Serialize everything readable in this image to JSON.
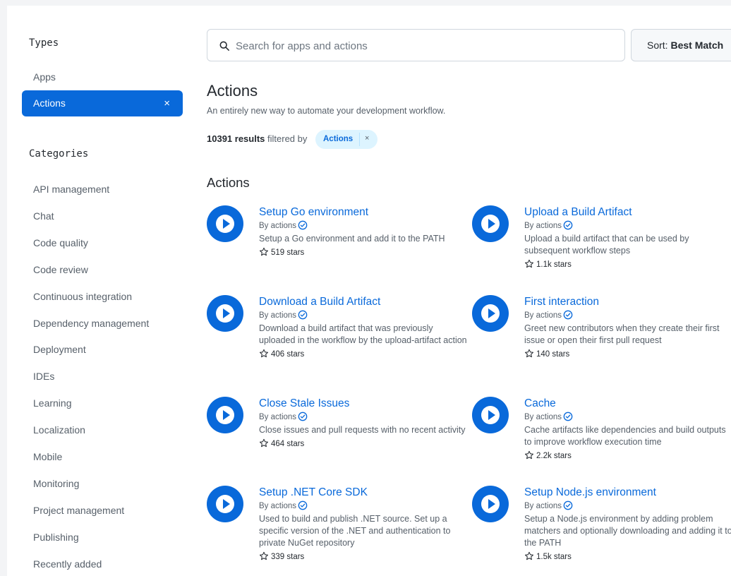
{
  "sidebar": {
    "types_heading": "Types",
    "types": [
      {
        "label": "Apps",
        "active": false
      },
      {
        "label": "Actions",
        "active": true,
        "close": "×"
      }
    ],
    "categories_heading": "Categories",
    "categories": [
      "API management",
      "Chat",
      "Code quality",
      "Code review",
      "Continuous integration",
      "Dependency management",
      "Deployment",
      "IDEs",
      "Learning",
      "Localization",
      "Mobile",
      "Monitoring",
      "Project management",
      "Publishing",
      "Recently added"
    ]
  },
  "search": {
    "placeholder": "Search for apps and actions",
    "value": ""
  },
  "sort": {
    "prefix": "Sort: ",
    "value": "Best Match"
  },
  "header": {
    "title": "Actions",
    "description": "An entirely new way to automate your development workflow.",
    "results_count": "10391 results",
    "filtered_by": " filtered by",
    "filter_chip": "Actions",
    "filter_chip_close": "×"
  },
  "section_title": "Actions",
  "colors": {
    "accent": "#0969da",
    "active_bg": "#0969da",
    "chip_bg": "#ddf4ff"
  },
  "cards": [
    {
      "name": "Setup Go environment",
      "by": "By actions",
      "desc": "Setup a Go environment and add it to the PATH",
      "stars": "519 stars",
      "icon": "play-icon"
    },
    {
      "name": "Upload a Build Artifact",
      "by": "By actions",
      "desc": "Upload a build artifact that can be used by subsequent workflow steps",
      "stars": "1.1k stars",
      "icon": "play-icon"
    },
    {
      "name": "Download a Build Artifact",
      "by": "By actions",
      "desc": "Download a build artifact that was previously uploaded in the workflow by the upload-artifact action",
      "stars": "406 stars",
      "icon": "play-icon"
    },
    {
      "name": "First interaction",
      "by": "By actions",
      "desc": "Greet new contributors when they create their first issue or open their first pull request",
      "stars": "140 stars",
      "icon": "play-icon"
    },
    {
      "name": "Close Stale Issues",
      "by": "By actions",
      "desc": "Close issues and pull requests with no recent activity",
      "stars": "464 stars",
      "icon": "play-icon"
    },
    {
      "name": "Cache",
      "by": "By actions",
      "desc": "Cache artifacts like dependencies and build outputs to improve workflow execution time",
      "stars": "2.2k stars",
      "icon": "play-icon"
    },
    {
      "name": "Setup .NET Core SDK",
      "by": "By actions",
      "desc": "Used to build and publish .NET source. Set up a specific version of the .NET and authentication to private NuGet repository",
      "stars": "339 stars",
      "icon": "play-icon"
    },
    {
      "name": "Setup Node.js environment",
      "by": "By actions",
      "desc": "Setup a Node.js environment by adding problem matchers and optionally downloading and adding it to the PATH",
      "stars": "1.5k stars",
      "icon": "play-icon"
    }
  ]
}
